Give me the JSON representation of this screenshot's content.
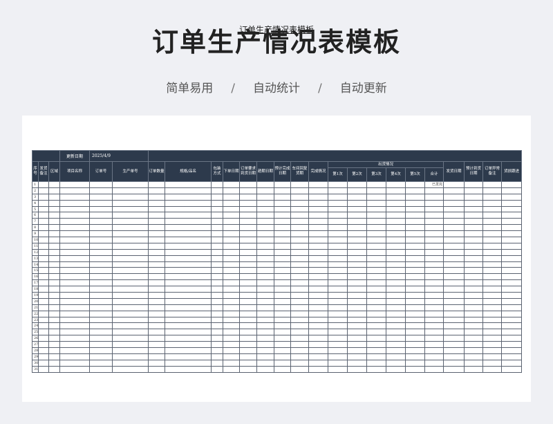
{
  "page": {
    "title": "订单生产情况表模板",
    "features": [
      "简单易用",
      "自动统计",
      "自动更新"
    ],
    "separator": "/"
  },
  "sheet": {
    "title": "订单生产情况表模板",
    "update_label": "更新日期",
    "update_value": "2025/4/9",
    "columns": {
      "seq": "序号",
      "ship_note": "发货备注",
      "region": "区域",
      "project": "项目名称",
      "order_no": "订单号",
      "prod_no": "生产单号",
      "qty": "订单数量",
      "spec": "规格/品名",
      "pack": "包装方式",
      "order_date": "下单日期",
      "req_date": "订单要求到货日期",
      "delivery": "趟期日期",
      "est_done": "预计完成日期",
      "workshop": "车间回复货期",
      "status": "完成情况",
      "shipment_group": "出货情况",
      "ship1": "第1次",
      "ship2": "第2次",
      "ship3": "第3次",
      "ship4": "第4次",
      "ship5": "第5次",
      "total": "合计",
      "ship_date": "发货日期",
      "est_arrival": "预计到货日期",
      "order_exception": "订单异常备注",
      "tracking": "货损跟进"
    },
    "rows": [
      "1",
      "2",
      "3",
      "4",
      "5",
      "6",
      "7",
      "8",
      "9",
      "10",
      "11",
      "12",
      "13",
      "14",
      "15",
      "16",
      "17",
      "18",
      "19",
      "20",
      "21",
      "22",
      "23",
      "24",
      "25",
      "26",
      "27",
      "28",
      "29",
      "30",
      "31"
    ],
    "first_row_total": "已发完"
  }
}
